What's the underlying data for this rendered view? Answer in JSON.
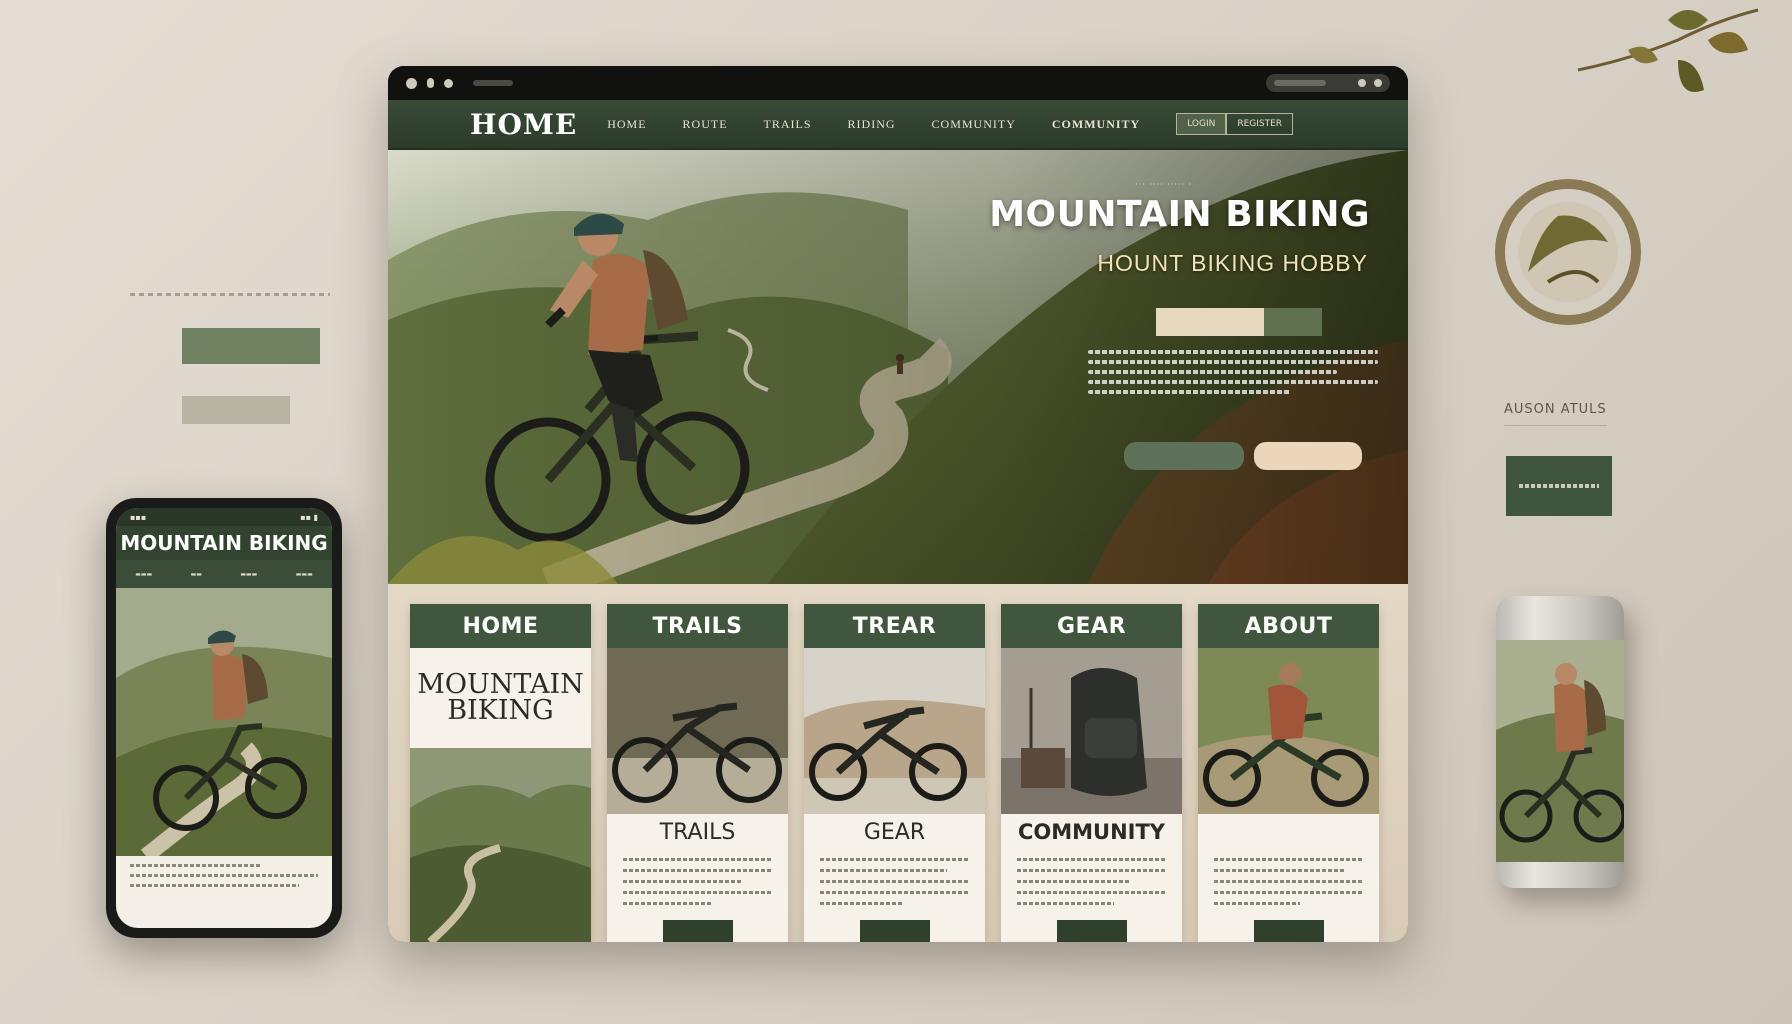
{
  "colors": {
    "forest": "#41563f",
    "navbar": "#2f3f2d",
    "cream": "#f6f2ea",
    "sand": "#e4d8c6",
    "accent_tan": "#ecd6b9"
  },
  "browser": {
    "nav": {
      "brand": "HOME",
      "links": [
        "HOME",
        "ROUTE",
        "TRAILS",
        "RIDING",
        "COMMUNITY",
        "COMMUNITY"
      ],
      "buttons": [
        "LOGIN",
        "REGISTER"
      ]
    },
    "hero": {
      "title": "MOUNTAIN BIKING",
      "subtitle": "HOUNT BIKING HOBBY"
    },
    "cards": [
      {
        "head": "HOME",
        "title_line1": "MOUNTAIN",
        "title_line2": "BIKING"
      },
      {
        "head": "TRAILS",
        "sub": "TRAILS"
      },
      {
        "head": "TREAR",
        "sub": "GEAR"
      },
      {
        "head": "GEAR",
        "sub": "COMMUNITY"
      },
      {
        "head": "ABOUT"
      }
    ]
  },
  "phone": {
    "title": "MOUNTAIN BIKING"
  },
  "right": {
    "label": "AUSON ATULS"
  },
  "icons": [
    "shield-icon",
    "settings-icon",
    "leaf-icon",
    "wheel-icon"
  ]
}
